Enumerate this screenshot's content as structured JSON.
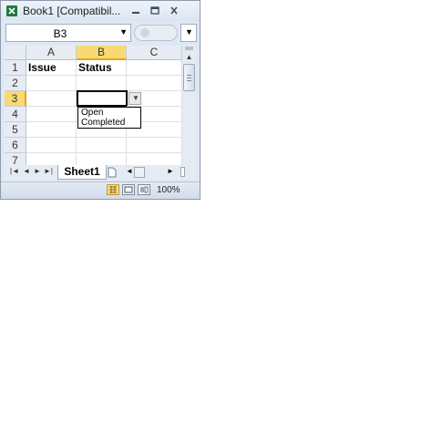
{
  "window": {
    "title": "Book1  [Compatibil...",
    "min_glyph": "—",
    "max_glyph": "☐",
    "close_glyph": "✕"
  },
  "namebox": {
    "value": "B3",
    "arrow": "▼"
  },
  "formula_bar": {
    "dd_arrow": "▼"
  },
  "columns": [
    "A",
    "B",
    "C"
  ],
  "rows": [
    "1",
    "2",
    "3",
    "4",
    "5",
    "6",
    "7"
  ],
  "cells": {
    "A1": "Issue",
    "B1": "Status"
  },
  "dropdown": {
    "arrow": "▼",
    "options": [
      "Open",
      "Completed"
    ]
  },
  "scrollbar": {
    "up": "▲"
  },
  "tabs": {
    "nav_first": "|◄",
    "nav_prev": "◄",
    "nav_next": "►",
    "nav_last": "►|",
    "sheet": "Sheet1",
    "left": "◄",
    "right": "►"
  },
  "status": {
    "zoom": "100%"
  }
}
